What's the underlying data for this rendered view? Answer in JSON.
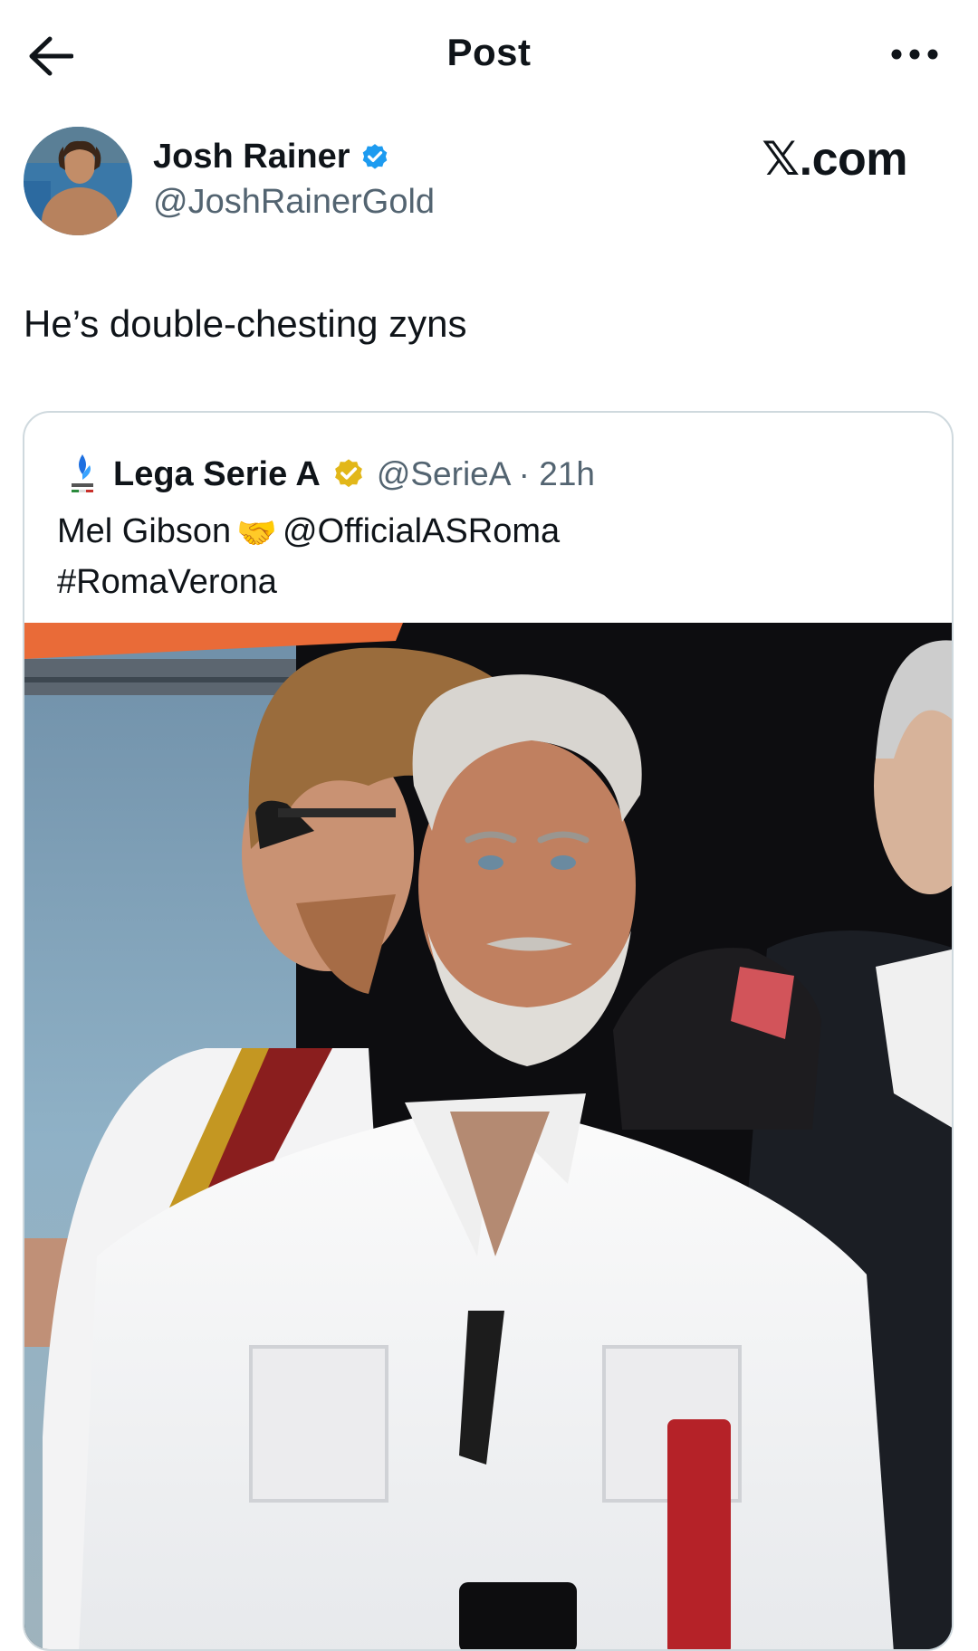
{
  "header": {
    "title": "Post",
    "back_icon": "arrow-left-icon",
    "more_icon": "more-horizontal-icon"
  },
  "author": {
    "name": "Josh Rainer",
    "handle": "@JoshRainerGold",
    "verified_icon": "verified-badge-icon",
    "verified_color": "#1d9bf0"
  },
  "brand": {
    "wordmark": "𝕏.com"
  },
  "post": {
    "text": "He’s double-chesting zyns"
  },
  "quoted_post": {
    "name": "Lega Serie A",
    "badge_icon": "gold-verified-badge-icon",
    "badge_color": "#e2b719",
    "meta": "@SerieA · 21h",
    "line1_text": "Mel Gibson",
    "emoji": "🤝",
    "mention": "@OfficialASRoma",
    "hashtag": "#RomaVerona",
    "logo_icon": "serie-a-logo-icon"
  }
}
